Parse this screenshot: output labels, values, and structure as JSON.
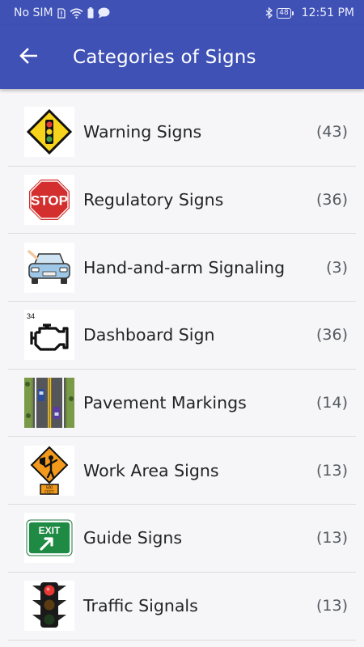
{
  "status_bar": {
    "carrier": "No SIM",
    "battery": "48",
    "time": "12:51 PM",
    "icons": [
      "sim-alert-icon",
      "wifi-icon",
      "battery-saver-icon",
      "message-icon",
      "bluetooth-icon"
    ]
  },
  "app_bar": {
    "title": "Categories of Signs",
    "back_icon": "arrow-left-icon"
  },
  "categories": [
    {
      "label": "Warning Signs",
      "count": "(43)",
      "icon": "traffic-light-warning-sign"
    },
    {
      "label": "Regulatory Signs",
      "count": "(36)",
      "icon": "stop-sign"
    },
    {
      "label": "Hand-and-arm Signaling",
      "count": "(3)",
      "icon": "car-hand-signal"
    },
    {
      "label": "Dashboard Sign",
      "count": "(36)",
      "icon": "check-engine-light",
      "icon_caption": "34"
    },
    {
      "label": "Pavement Markings",
      "count": "(14)",
      "icon": "road-lanes"
    },
    {
      "label": "Work Area Signs",
      "count": "(13)",
      "icon": "flagger-sign",
      "icon_caption": "500 FEET"
    },
    {
      "label": "Guide Signs",
      "count": "(13)",
      "icon": "exit-sign",
      "icon_caption": "EXIT"
    },
    {
      "label": "Traffic Signals",
      "count": "(13)",
      "icon": "traffic-signal"
    }
  ],
  "colors": {
    "primary": "#3f51b5",
    "background": "#f6f6f8",
    "divider": "#dcdce0"
  }
}
